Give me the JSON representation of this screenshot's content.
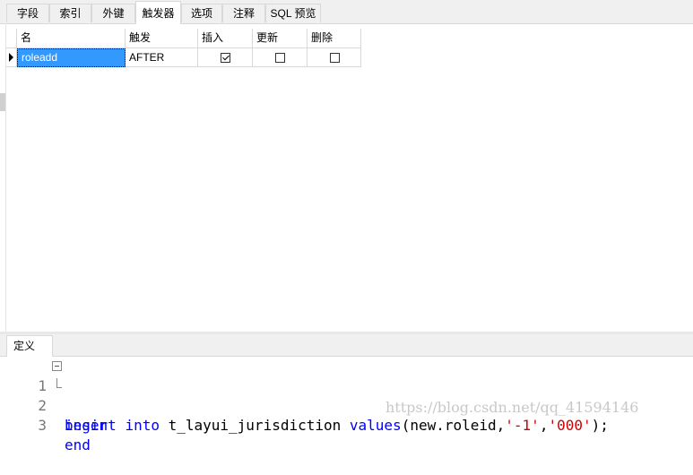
{
  "tabs": [
    {
      "label": "字段",
      "active": false
    },
    {
      "label": "索引",
      "active": false
    },
    {
      "label": "外键",
      "active": false
    },
    {
      "label": "触发器",
      "active": true
    },
    {
      "label": "选项",
      "active": false
    },
    {
      "label": "注释",
      "active": false
    },
    {
      "label": "SQL 预览",
      "active": false
    }
  ],
  "grid": {
    "headers": [
      "名",
      "触发",
      "插入",
      "更新",
      "删除"
    ],
    "rows": [
      {
        "name": "roleadd",
        "fire": "AFTER",
        "insert": true,
        "update": false,
        "delete": false
      }
    ]
  },
  "definition": {
    "tab_label": "定义",
    "lines": [
      {
        "num": "1",
        "tokens": [
          {
            "t": "begin",
            "k": "kw"
          }
        ]
      },
      {
        "num": "2",
        "tokens": [
          {
            "t": "insert",
            "k": "kw"
          },
          {
            "t": " ",
            "k": ""
          },
          {
            "t": "into",
            "k": "kw"
          },
          {
            "t": " t_layui_jurisdiction ",
            "k": ""
          },
          {
            "t": "values",
            "k": "kw"
          },
          {
            "t": "(new.roleid,",
            "k": ""
          },
          {
            "t": "'-1'",
            "k": "str"
          },
          {
            "t": ",",
            "k": ""
          },
          {
            "t": "'000'",
            "k": "str"
          },
          {
            "t": ");",
            "k": ""
          }
        ]
      },
      {
        "num": "3",
        "tokens": [
          {
            "t": "end",
            "k": "kw"
          }
        ]
      }
    ]
  },
  "watermark": "https://blog.csdn.net/qq_41594146"
}
